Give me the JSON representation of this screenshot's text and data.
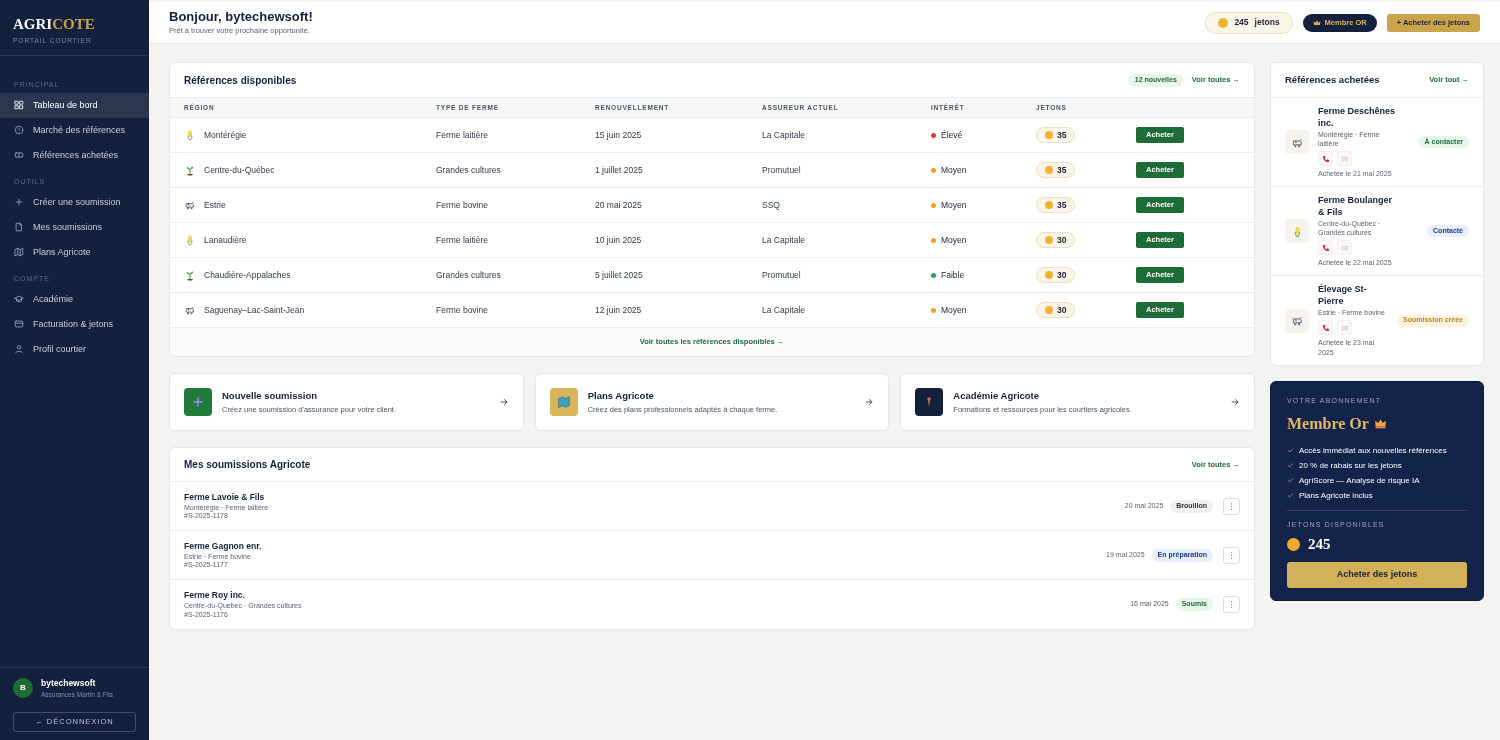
{
  "sidebar": {
    "logo": {
      "first": "AGRI",
      "second": "COTE"
    },
    "subtitle": "PORTAIL COURTIER",
    "sections": [
      {
        "title": "PRINCIPAL",
        "items": [
          {
            "label": "Tableau de bord",
            "selected": true
          },
          {
            "label": "Marché des références",
            "selected": false
          },
          {
            "label": "Références achetées",
            "selected": false
          }
        ]
      },
      {
        "title": "OUTILS",
        "items": [
          {
            "label": "Créer une soumission",
            "selected": false
          },
          {
            "label": "Mes soumissions",
            "selected": false
          },
          {
            "label": "Plans Agricote",
            "selected": false
          }
        ]
      },
      {
        "title": "COMPTE",
        "items": [
          {
            "label": "Académie",
            "selected": false
          },
          {
            "label": "Facturation & jetons",
            "selected": false
          },
          {
            "label": "Profil courtier",
            "selected": false
          }
        ]
      }
    ],
    "user": {
      "initial": "B",
      "name": "bytechewsoft",
      "company": "Assurances Martin & Fils"
    },
    "logout": "← DÉCONNEXION"
  },
  "header": {
    "greeting": "Bonjour, bytechewsoft!",
    "subtitle": "Prêt à trouver votre prochaine opportunité.",
    "tokens": "245",
    "tokens_label": "jetons",
    "membership": "Membre OR",
    "buy": "+ Acheter des jetons"
  },
  "available": {
    "title": "Références disponibles",
    "badge": "12 nouvelles",
    "link": "Voir toutes →",
    "columns": [
      "RÉGION",
      "TYPE DE FERME",
      "RENOUVELLEMENT",
      "ASSUREUR ACTUEL",
      "INTÉRÊT",
      "JETONS"
    ],
    "rows": [
      {
        "kind": "dairy",
        "region": "Montérégie",
        "type": "Ferme laitière",
        "renewal": "15 juin 2025",
        "insurer": "La Capitale",
        "interest": "Élevé",
        "color": "#dc3b3b",
        "tokens": "35",
        "action": "Acheter"
      },
      {
        "kind": "crops",
        "region": "Centre-du-Québec",
        "type": "Grandes cultures",
        "renewal": "1 juillet 2025",
        "insurer": "Promutuel",
        "interest": "Moyen",
        "color": "#f0a020",
        "tokens": "35",
        "action": "Acheter"
      },
      {
        "kind": "beef",
        "region": "Estrie",
        "type": "Ferme bovine",
        "renewal": "20 mai 2025",
        "insurer": "SSQ",
        "interest": "Moyen",
        "color": "#f0a020",
        "tokens": "35",
        "action": "Acheter"
      },
      {
        "kind": "dairy",
        "region": "Lanaudière",
        "type": "Ferme laitière",
        "renewal": "10 juin 2025",
        "insurer": "La Capitale",
        "interest": "Moyen",
        "color": "#f0a020",
        "tokens": "30",
        "action": "Acheter"
      },
      {
        "kind": "crops",
        "region": "Chaudière-Appalaches",
        "type": "Grandes cultures",
        "renewal": "5 juillet 2025",
        "insurer": "Promutuel",
        "interest": "Faible",
        "color": "#22a55a",
        "tokens": "30",
        "action": "Acheter"
      },
      {
        "kind": "beef",
        "region": "Saguenay–Lac-Saint-Jean",
        "type": "Ferme bovine",
        "renewal": "12 juin 2025",
        "insurer": "La Capitale",
        "interest": "Moyen",
        "color": "#f0a020",
        "tokens": "30",
        "action": "Acheter"
      }
    ],
    "footer_link": "Voir toutes les références disponibles →"
  },
  "actions": [
    {
      "kind": "plus",
      "title": "Nouvelle soumission",
      "text": "Créez une soumission d'assurance pour votre client."
    },
    {
      "kind": "map",
      "title": "Plans Agricote",
      "text": "Créez des plans professionnels adaptés à chaque ferme."
    },
    {
      "kind": "academy",
      "title": "Académie Agricote",
      "text": "Formations et ressources pour les courtiers agricoles."
    }
  ],
  "submissions": {
    "title": "Mes soumissions Agricote",
    "link": "Voir toutes →",
    "rows": [
      {
        "name": "Ferme Lavoie & Fils",
        "details": "Montérégie · Ferme laitière",
        "ref": "#S-2025-1178",
        "date": "20 mai 2025",
        "status": "Brouillon",
        "kind": "draft"
      },
      {
        "name": "Ferme Gagnon enr.",
        "details": "Estrie · Ferme bovine",
        "ref": "#S-2025-1177",
        "date": "19 mai 2025",
        "status": "En préparation",
        "kind": "progress"
      },
      {
        "name": "Ferme Roy inc.",
        "details": "Centre-du-Québec · Grandes cultures",
        "ref": "#S-2025-1176",
        "date": "16 mai 2025",
        "status": "Soumis",
        "kind": "done"
      }
    ]
  },
  "purchased": {
    "title": "Références achetées",
    "link": "Voir tout →",
    "items": [
      {
        "kind": "beef",
        "name": "Ferme Deschênes inc.",
        "details": "Montérégie · Ferme laitière",
        "date": "Achetée le 21 mai 2025",
        "status": {
          "text": "À contacter",
          "kind": "todo"
        }
      },
      {
        "kind": "dairy",
        "name": "Ferme Boulanger & Fils",
        "details": "Centre-du-Québec · Grandes cultures",
        "date": "Achetée le 22 mai 2025",
        "status": {
          "text": "Contacté",
          "kind": "contacted"
        }
      },
      {
        "kind": "beef",
        "name": "Élevage St-Pierre",
        "details": "Estrie · Ferme bovine",
        "date": "Achetée le 23 mai 2025",
        "status": {
          "text": "Soumission créée",
          "kind": "created"
        }
      }
    ]
  },
  "subscription": {
    "label": "VOTRE ABONNEMENT",
    "plan": "Membre Or",
    "perks": [
      "Accès immédiat aux nouvelles références",
      "20 % de rabais sur les jetons",
      "AgriScore — Analyse de risque IA",
      "Plans Agricote inclus"
    ],
    "tokens_label": "JETONS DISPONIBLES",
    "tokens": "245",
    "button": "Acheter des jetons"
  }
}
